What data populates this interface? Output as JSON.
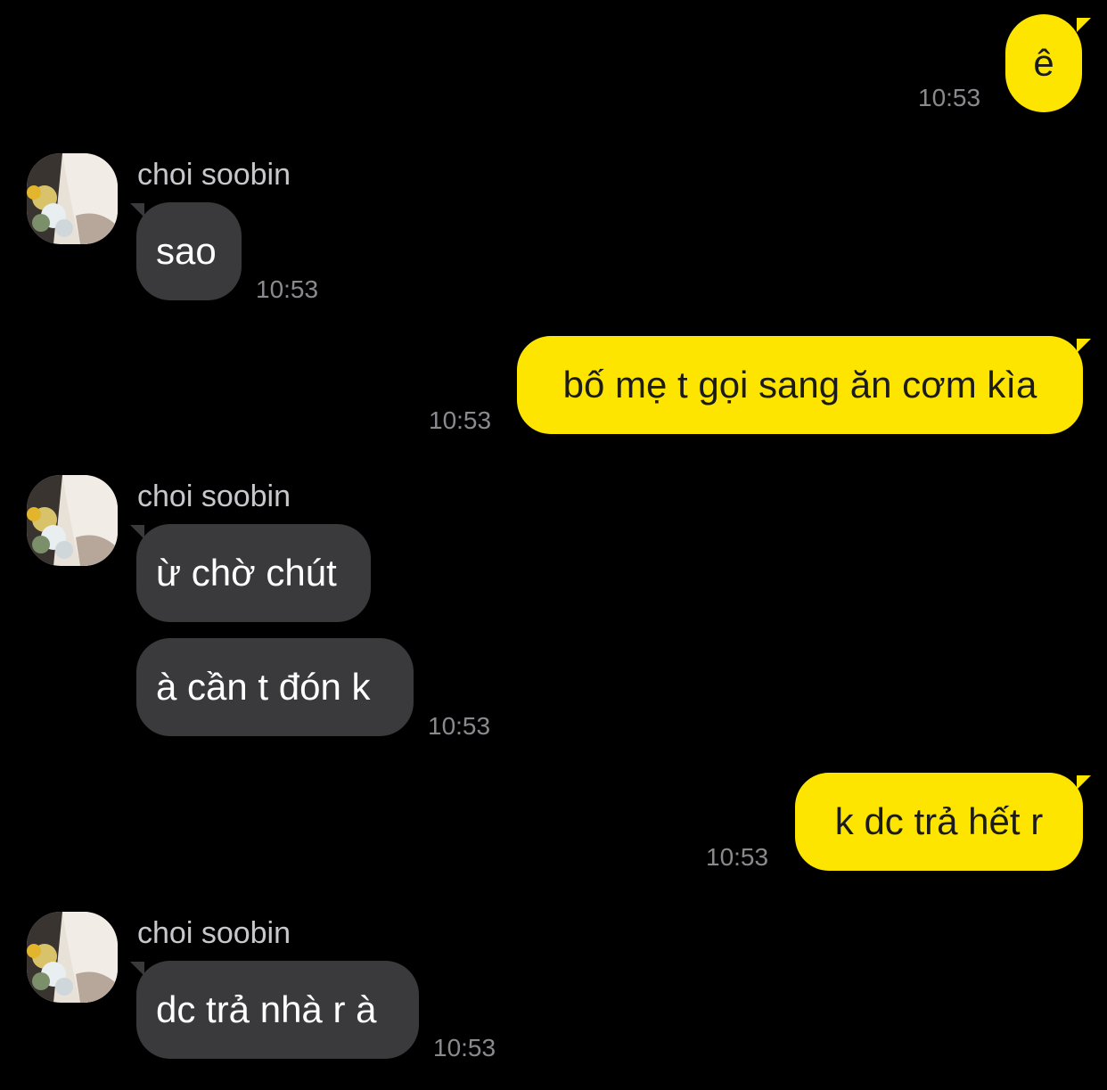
{
  "contact": {
    "name": "choi soobin"
  },
  "messages": [
    {
      "from": "me",
      "text": "ê",
      "time": "10:53"
    },
    {
      "from": "them",
      "text": "sao",
      "time": "10:53"
    },
    {
      "from": "me",
      "text": "bố mẹ t gọi sang ăn cơm kìa",
      "time": "10:53"
    },
    {
      "from": "them",
      "text": "ừ chờ chút",
      "time": ""
    },
    {
      "from": "them",
      "text": "à cần t đón k",
      "time": "10:53"
    },
    {
      "from": "me",
      "text": "k dc trả hết r",
      "time": "10:53"
    },
    {
      "from": "them",
      "text": "dc trả nhà r à",
      "time": "10:53"
    }
  ],
  "colors": {
    "background": "#000000",
    "outgoing_bubble": "#FEE500",
    "incoming_bubble": "#3a3a3c",
    "timestamp": "#8a8a8e"
  },
  "icons": {
    "avatar": "contact-avatar-photo"
  }
}
